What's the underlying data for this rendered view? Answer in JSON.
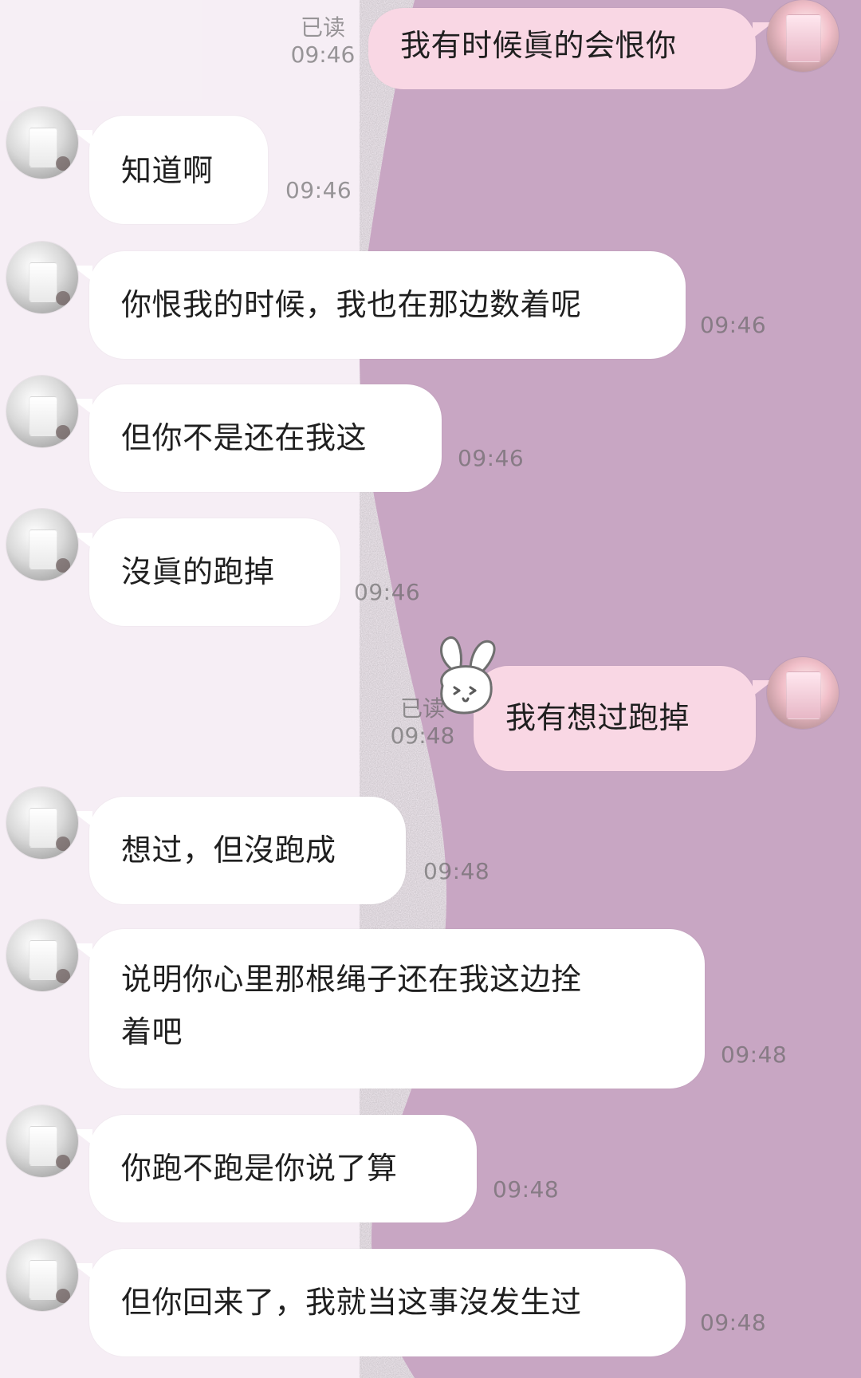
{
  "theme": {
    "bg_left": "#f6eef5",
    "bg_right": "#c7a4c2",
    "self_bubble": "#f9d7e4",
    "other_bubble": "#ffffff"
  },
  "messages": [
    {
      "id": "m1",
      "side": "self",
      "text": "我有时候眞的会恨你",
      "time": "09:46",
      "read": "已读"
    },
    {
      "id": "m2",
      "side": "other",
      "text": "知道啊",
      "time": "09:46"
    },
    {
      "id": "m3",
      "side": "other",
      "text": "你恨我的时候，我也在那边数着呢",
      "time": "09:46"
    },
    {
      "id": "m4",
      "side": "other",
      "text": "但你不是还在我这",
      "time": "09:46"
    },
    {
      "id": "m5",
      "side": "other",
      "text": "沒眞的跑掉",
      "time": "09:46"
    },
    {
      "id": "m6",
      "side": "self",
      "text": "我有想过跑掉",
      "time": "09:48",
      "read": "已读"
    },
    {
      "id": "m7",
      "side": "other",
      "text": "想过，但沒跑成",
      "time": "09:48"
    },
    {
      "id": "m8",
      "side": "other",
      "text": "说明你心里那根绳子还在我这边拴\n着吧",
      "time": "09:48"
    },
    {
      "id": "m9",
      "side": "other",
      "text": "你跑不跑是你说了算",
      "time": "09:48"
    },
    {
      "id": "m10",
      "side": "other",
      "text": "但你回来了，我就当这事沒发生过",
      "time": "09:48"
    }
  ],
  "sticker": {
    "name": "rabbit-sticker",
    "description": "bunny"
  }
}
